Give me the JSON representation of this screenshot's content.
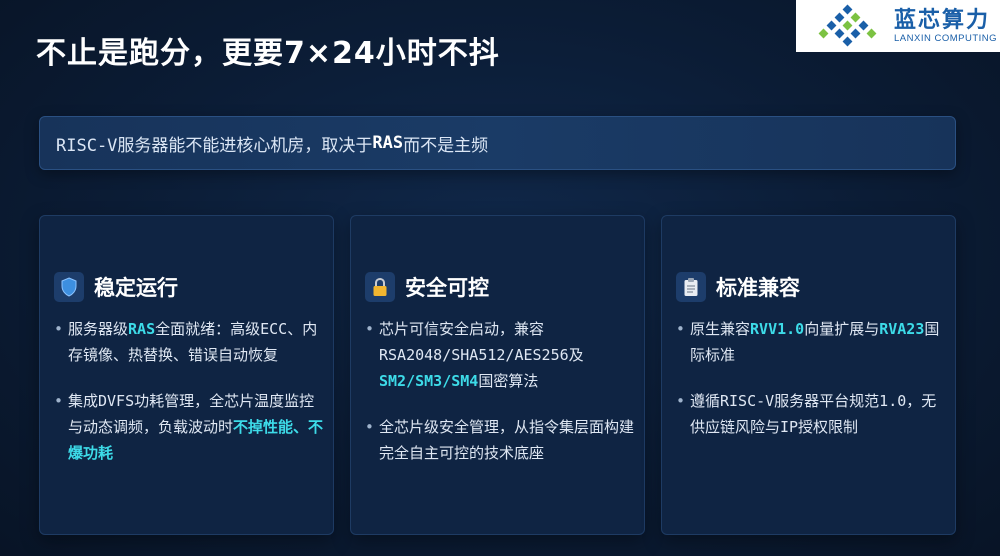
{
  "title": "不止是跑分，更要7×24小时不抖",
  "logo": {
    "cn": "蓝芯算力",
    "en": "LANXIN COMPUTING",
    "color": "#1a5fa8"
  },
  "banner": {
    "prefix": "RISC-V服务器能不能进核心机房，取决于",
    "bold": "RAS",
    "suffix": "而不是主频"
  },
  "accent_color": "#3ddbe8",
  "cards": [
    {
      "icon": "shield-icon",
      "title": "稳定运行",
      "b1": {
        "t1": "服务器级",
        "h1": "RAS",
        "t2": "全面就绪：高级ECC、内存镜像、热替换、错误自动恢复"
      },
      "b2": {
        "t1": "集成DVFS功耗管理，全芯片温度监控与动态调频，负载波动时",
        "h1": "不掉性能、不爆功耗"
      }
    },
    {
      "icon": "lock-icon",
      "title": "安全可控",
      "b1": {
        "t1": "芯片可信安全启动，兼容RSA2048/SHA512/AES256及",
        "h1": "SM2/SM3/SM4",
        "t2": "国密算法"
      },
      "b2": {
        "t1": "全芯片级安全管理，从指令集层面构建完全自主可控的技术底座"
      }
    },
    {
      "icon": "clipboard-icon",
      "title": "标准兼容",
      "b1": {
        "t1": "原生兼容",
        "h1": "RVV1.0",
        "t2": "向量扩展与",
        "h2": "RVA23",
        "t3": "国际标准"
      },
      "b2": {
        "t1": "遵循RISC-V服务器平台规范1.0，无供应链风险与IP授权限制"
      }
    }
  ]
}
